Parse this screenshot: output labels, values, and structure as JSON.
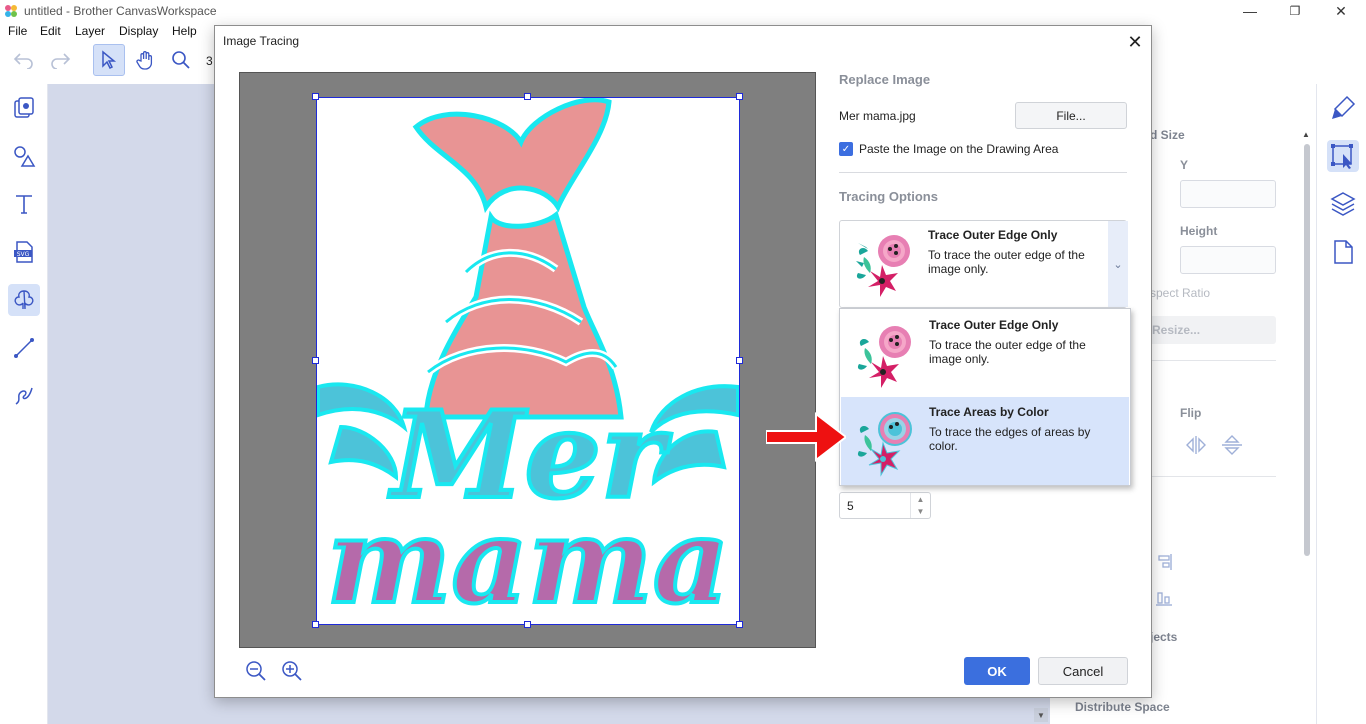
{
  "window": {
    "title": "untitled - Brother CanvasWorkspace",
    "controls": {
      "minimize": "—",
      "restore": "❐",
      "close": "✕"
    }
  },
  "menu": [
    "File",
    "Edit",
    "Layer",
    "Display",
    "Help"
  ],
  "toolbar": {
    "zoom_value": "3"
  },
  "right_panel": {
    "size_heading": "d Size",
    "y_label": "Y",
    "height_label": "Height",
    "aspect_label": "spect Ratio",
    "resize_label": "Resize...",
    "flip_label": "Flip",
    "objects_label": "jects",
    "distribute_label": "Distribute Space"
  },
  "dialog": {
    "title": "Image Tracing",
    "close_glyph": "✕",
    "replace_image_heading": "Replace Image",
    "filename": "Mer mama.jpg",
    "file_button": "File...",
    "paste_checkbox_label": "Paste the Image on the Drawing Area",
    "paste_checked": true,
    "tracing_options_heading": "Tracing Options",
    "selected_option": {
      "title": "Trace Outer Edge Only",
      "desc": "To trace the outer edge of the image only."
    },
    "dropdown_options": [
      {
        "title": "Trace Outer Edge Only",
        "desc": "To trace the outer edge of the image only."
      },
      {
        "title": "Trace Areas by Color",
        "desc": "To trace the edges of areas by color."
      }
    ],
    "spin_value": "5",
    "ok_button": "OK",
    "cancel_button": "Cancel"
  },
  "colors": {
    "accent": "#3b6fde",
    "highlight": "#d7e4fb",
    "tail_pink": "#e89494",
    "text_teal": "#4cc3d9",
    "text_purple": "#b56aaa",
    "outline_cyan": "#19e8f0",
    "arrow_red": "#ee1111"
  }
}
